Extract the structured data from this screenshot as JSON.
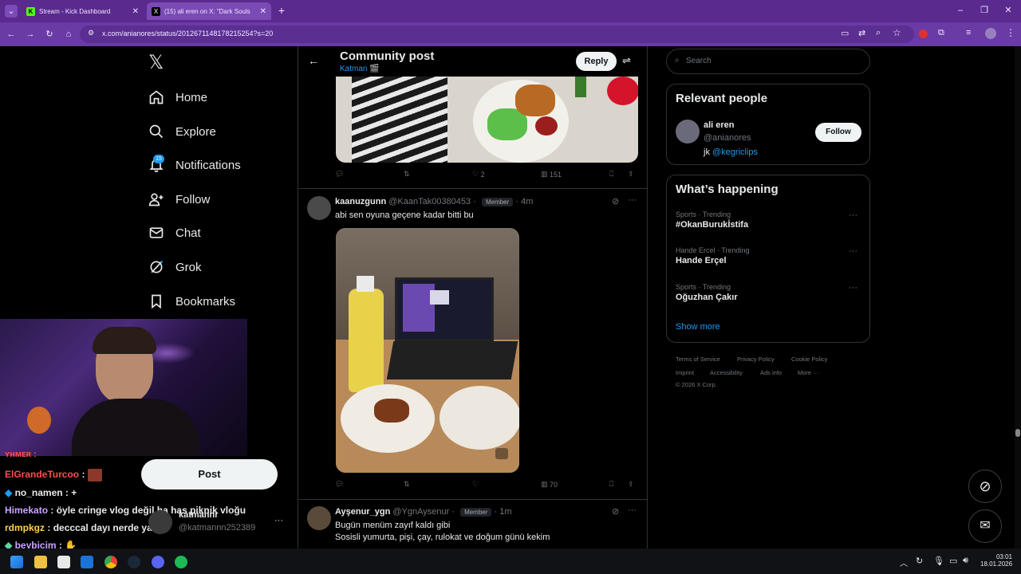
{
  "browser": {
    "tabs": [
      {
        "title": "Stream - Kick Dashboard",
        "favicon": "kick-icon",
        "active": false
      },
      {
        "title": "(15) ali eren on X: \"Dark Souls",
        "favicon": "x-icon",
        "active": true
      }
    ],
    "url": "x.com/anianores/status/2012671148178215254?s=20",
    "new_tab_symbol": "+",
    "close_symbol": "✕"
  },
  "sidebar": {
    "logo": "𝕏",
    "items": [
      {
        "label": "Home",
        "icon": "home-icon"
      },
      {
        "label": "Explore",
        "icon": "search-icon"
      },
      {
        "label": "Notifications",
        "icon": "bell-icon",
        "badge": "15"
      },
      {
        "label": "Follow",
        "icon": "follow-icon"
      },
      {
        "label": "Chat",
        "icon": "mail-icon"
      },
      {
        "label": "Grok",
        "icon": "grok-icon"
      },
      {
        "label": "Bookmarks",
        "icon": "bookmark-icon"
      }
    ],
    "post_label": "Post",
    "account": {
      "name": "katmannr",
      "handle": "@katmannn252389",
      "more": "···"
    }
  },
  "header": {
    "title": "Community post",
    "community": "Katman 🎬",
    "reply_label": "Reply"
  },
  "post1": {
    "likes": "2",
    "views": "151"
  },
  "post2": {
    "name": "kaanuzgunn",
    "handle": "@KaanTak00380453",
    "role": "Member",
    "time": "4m",
    "text": "abi sen oyuna geçene kadar bitti bu",
    "views": "70",
    "more": "···"
  },
  "post3": {
    "name": "Ayşenur_ygn",
    "handle": "@YgnAysenur",
    "role": "Member",
    "time": "1m",
    "line1": "Bugün menüm zayıf kaldı gibi",
    "line2": "Sosisli yumurta, pişi, çay, rulokat ve doğum günü kekim",
    "more": "···"
  },
  "search": {
    "placeholder": "Search"
  },
  "relevant": {
    "title": "Relevant people",
    "name": "ali eren",
    "handle": "@anianores",
    "bio_prefix": "jk",
    "bio_link": "@kegriclips",
    "follow_label": "Follow"
  },
  "happening": {
    "title": "What’s happening",
    "trends": [
      {
        "category": "Sports · Trending",
        "name": "#OkanBurukİstifa"
      },
      {
        "category": "Hande Ercel · Trending",
        "name": "Hande Erçel"
      },
      {
        "category": "Sports · Trending",
        "name": "Oğuzhan Çakır"
      }
    ],
    "show_more": "Show more",
    "more": "···"
  },
  "footer": {
    "links": [
      "Terms of Service",
      "Privacy Policy",
      "Cookie Policy",
      "Imprint",
      "Accessibility",
      "Ads info",
      "More ···"
    ],
    "copyright": "© 2026 X Corp."
  },
  "chat": [
    {
      "user": "ElGrandeTurcoo",
      "message": "",
      "color": "#ff4d4d"
    },
    {
      "user": "no_namen",
      "message": "+",
      "color": "#e7e9ea"
    },
    {
      "user": "Himekato",
      "message": "öyle cringe vlog değil ha has piknik vloğu",
      "color": "#c9a4ff"
    },
    {
      "user": "rdmpkgz",
      "message": "decccal dayı nerde yaa",
      "color": "#ffd24d"
    },
    {
      "user": "beybicim",
      "message": "",
      "color": "#c9a4ff"
    }
  ],
  "taskbar": {
    "time": "03:01",
    "date": "18.01.2026"
  },
  "colors": {
    "accent": "#1d9bf0",
    "chrome": "#5a2a8f",
    "background": "#000000"
  }
}
